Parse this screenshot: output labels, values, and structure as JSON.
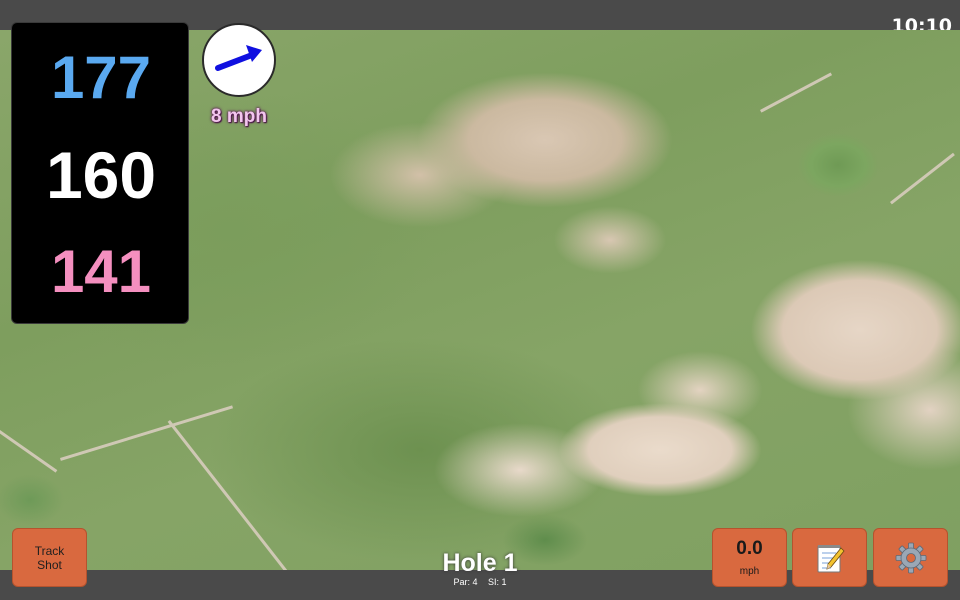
{
  "status": {
    "time": "10:10"
  },
  "distances": {
    "back": "177",
    "middle": "160",
    "front": "141"
  },
  "wind": {
    "speed_label": "8 mph",
    "direction_icon": "wind-arrow-icon",
    "arrow_color": "#1010e0"
  },
  "hole": {
    "title": "Hole 1",
    "par": "Par: 4",
    "stroke_index": "SI: 1"
  },
  "buttons": {
    "track_shot_label": "Track Shot",
    "speed_value": "0.0",
    "speed_unit": "mph",
    "notes_icon": "notepad-icon",
    "settings_icon": "gear-icon"
  },
  "colors": {
    "back": "#5aa9f0",
    "middle": "#ffffff",
    "front": "#f48fbf",
    "button": "#d9693f",
    "bar": "#4a4a4a"
  }
}
